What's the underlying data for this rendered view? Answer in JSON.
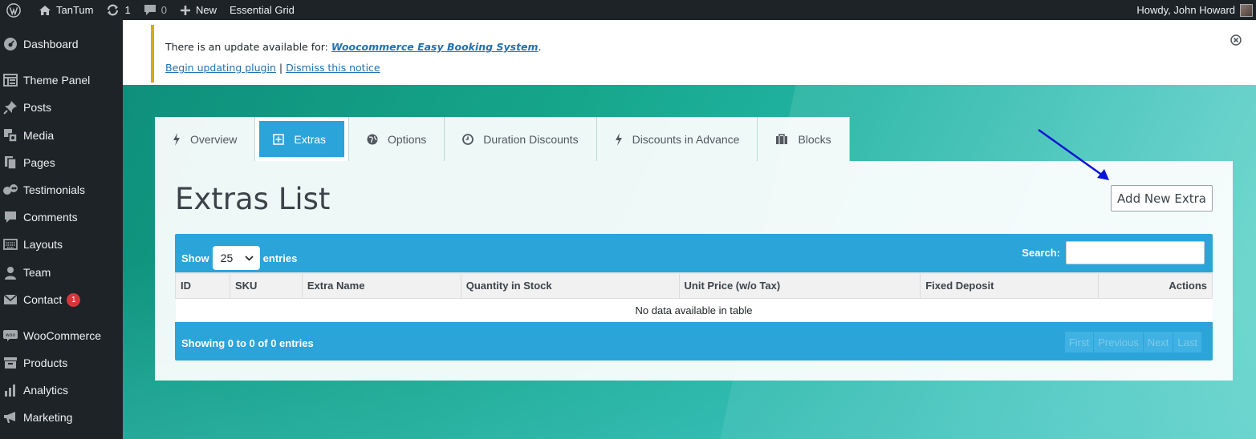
{
  "adminbar": {
    "site_name": "TanTum",
    "updates_count": "1",
    "comments_count": "0",
    "new_label": "New",
    "plugin_label": "Essential Grid",
    "howdy": "Howdy, John Howard"
  },
  "sidebar": {
    "items": [
      {
        "label": "Dashboard",
        "icon": "dashboard-icon"
      },
      {
        "label": "Theme Panel",
        "icon": "theme-panel-icon"
      },
      {
        "label": "Posts",
        "icon": "pin-icon"
      },
      {
        "label": "Media",
        "icon": "media-icon"
      },
      {
        "label": "Pages",
        "icon": "pages-icon"
      },
      {
        "label": "Testimonials",
        "icon": "testimonials-icon"
      },
      {
        "label": "Comments",
        "icon": "comment-icon"
      },
      {
        "label": "Layouts",
        "icon": "keyboard-icon"
      },
      {
        "label": "Team",
        "icon": "person-icon"
      },
      {
        "label": "Contact",
        "icon": "mail-icon",
        "badge": "1"
      },
      {
        "label": "WooCommerce",
        "icon": "woo-icon"
      },
      {
        "label": "Products",
        "icon": "archive-icon"
      },
      {
        "label": "Analytics",
        "icon": "bar-chart-icon"
      },
      {
        "label": "Marketing",
        "icon": "megaphone-icon"
      }
    ]
  },
  "notice": {
    "prefix": "There is an update available for: ",
    "plugin_name": "Woocommerce Easy Booking System",
    "suffix": ".",
    "begin_update": "Begin updating plugin",
    "separator": " | ",
    "dismiss": "Dismiss this notice"
  },
  "tabs": [
    {
      "label": "Overview",
      "icon": "bolt-icon",
      "active": false
    },
    {
      "label": "Extras",
      "icon": "plus-square-icon",
      "active": true
    },
    {
      "label": "Options",
      "icon": "globe-icon",
      "active": false
    },
    {
      "label": "Duration Discounts",
      "icon": "clock-icon",
      "active": false
    },
    {
      "label": "Discounts in Advance",
      "icon": "bolt-icon",
      "active": false
    },
    {
      "label": "Blocks",
      "icon": "briefcase-icon",
      "active": false
    }
  ],
  "panel": {
    "title": "Extras List",
    "add_button": "Add New Extra"
  },
  "table": {
    "show_label": "Show",
    "entries_value": "25",
    "entries_label": "entries",
    "search_label": "Search:",
    "columns": [
      "ID",
      "SKU",
      "Extra Name",
      "Quantity in Stock",
      "Unit Price (w/o Tax)",
      "Fixed Deposit",
      "Actions"
    ],
    "empty_message": "No data available in table",
    "info": "Showing 0 to 0 of 0 entries",
    "pager": [
      "First",
      "Previous",
      "Next",
      "Last"
    ]
  },
  "colors": {
    "accent": "#2ba4da",
    "notice_border": "#dba617",
    "link": "#2271b1",
    "annotation_arrow": "#0a14d8"
  }
}
